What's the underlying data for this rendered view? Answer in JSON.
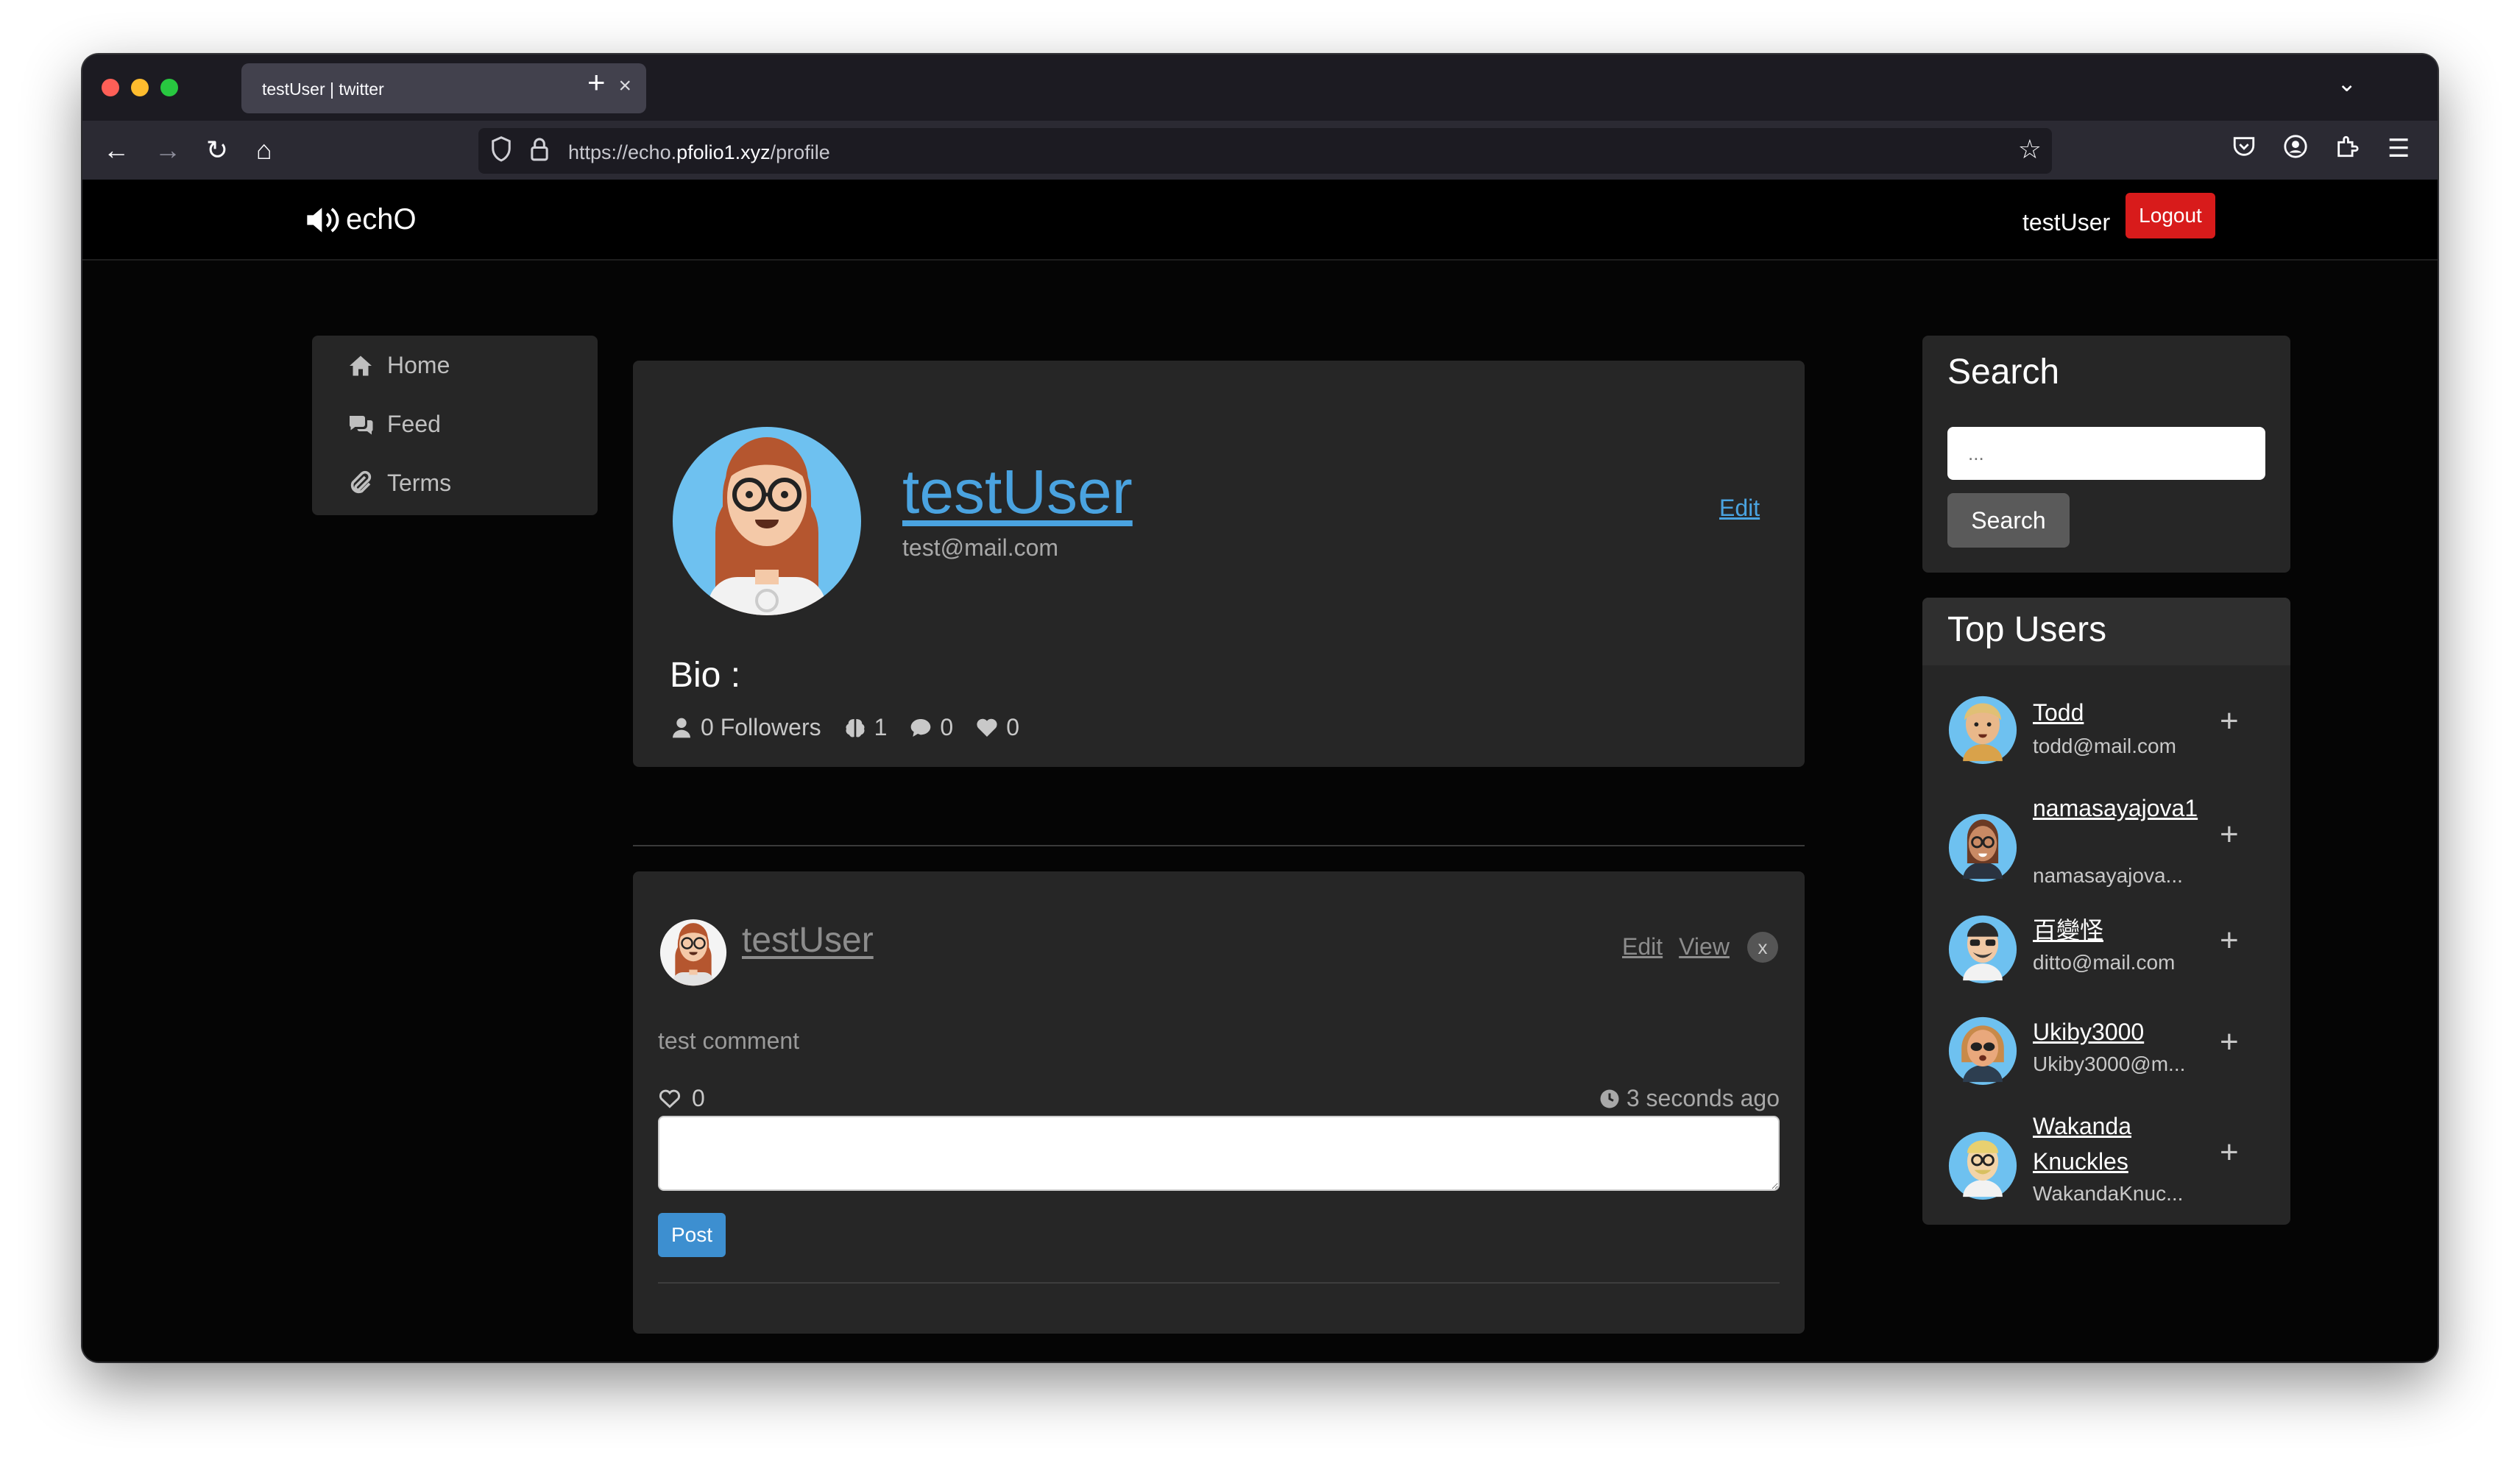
{
  "browser": {
    "tab_title": "testUser | twitter",
    "tab_close": "×",
    "new_tab": "+",
    "url_prefix": "https://echo.",
    "url_host": "pfolio1.xyz",
    "url_path": "/profile"
  },
  "header": {
    "logo_text": "echO",
    "username": "testUser",
    "logout_label": "Logout"
  },
  "sidebar": {
    "items": [
      {
        "label": "Home",
        "icon": "home-icon"
      },
      {
        "label": "Feed",
        "icon": "comments-icon"
      },
      {
        "label": "Terms",
        "icon": "paperclip-icon"
      }
    ]
  },
  "profile": {
    "name": "testUser",
    "email": "test@mail.com",
    "edit_label": "Edit",
    "bio_label": "Bio :",
    "followers": "0 Followers",
    "posts_count": "1",
    "comments_count": "0",
    "likes_count": "0"
  },
  "post": {
    "user": "testUser",
    "edit_label": "Edit",
    "view_label": "View",
    "delete_label": "x",
    "body": "test comment",
    "likes": "0",
    "timestamp": "3 seconds ago",
    "post_button": "Post"
  },
  "search": {
    "title": "Search",
    "placeholder": "...",
    "button": "Search"
  },
  "top_users": {
    "title": "Top Users",
    "users": [
      {
        "name": "Todd",
        "email": "todd@mail.com"
      },
      {
        "name": "namasayajova1",
        "email": "namasayajova..."
      },
      {
        "name": "百變怪",
        "email": "ditto@mail.com"
      },
      {
        "name": "Ukiby3000",
        "email": "Ukiby3000@m..."
      },
      {
        "name": "Wakanda Knuckles",
        "email": "WakandaKnuc..."
      }
    ],
    "add_symbol": "+"
  },
  "colors": {
    "accent": "#4aa3e0",
    "logout": "#d81b1b",
    "card": "#262626",
    "page_bg": "#050505"
  }
}
